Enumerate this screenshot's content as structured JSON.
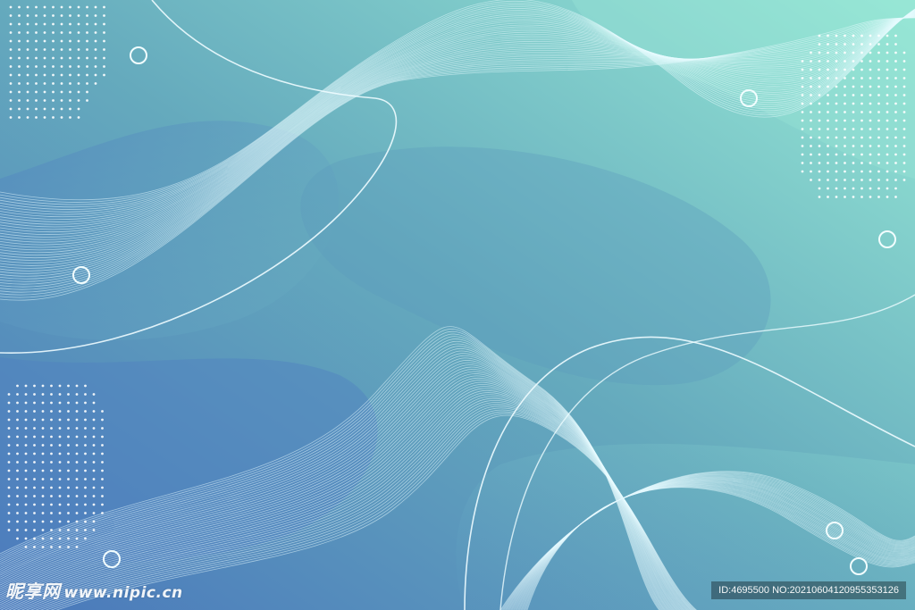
{
  "watermark": {
    "logo_text": "昵享网",
    "url": "www.nipic.cn"
  },
  "id_bar": {
    "text": "ID:4695500 NO:20210604120955353126"
  },
  "colors": {
    "bg_left": "#4a7fc0",
    "bg_right": "#8ee0d0",
    "line": "#e8fbff"
  }
}
